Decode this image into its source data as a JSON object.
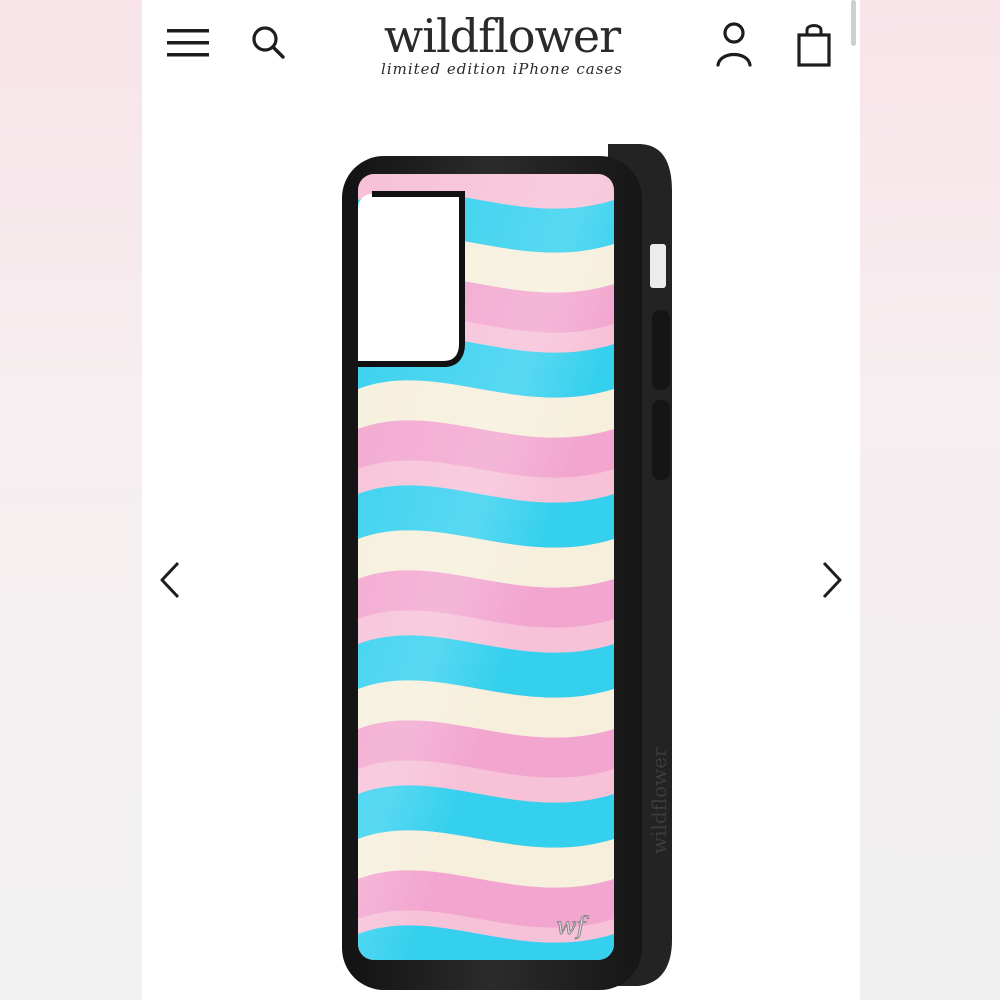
{
  "header": {
    "logo_text": "wildflower",
    "tagline": "limited edition iPhone cases",
    "icons": {
      "menu": "hamburger-menu-icon",
      "search": "search-icon",
      "account": "account-icon",
      "bag": "shopping-bag-icon"
    }
  },
  "gallery": {
    "prev_icon": "chevron-left-icon",
    "next_icon": "chevron-right-icon",
    "product": {
      "case_print_text": "wildflower",
      "monogram": "wf",
      "colors": {
        "bumper": "#1f1f1f",
        "pink": "#f2a6cf",
        "light_pink": "#f7c1d8",
        "blue": "#34d0ee",
        "cream": "#f6efdc"
      }
    }
  }
}
